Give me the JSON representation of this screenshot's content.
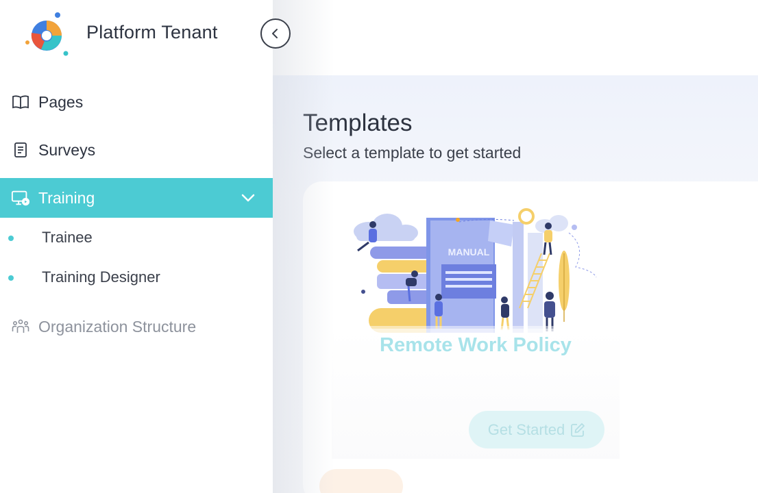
{
  "brand": {
    "name": "Platform Tenant",
    "logo_icon": "platform-logo-icon"
  },
  "sidebar": {
    "collapse_icon": "chevron-left-icon",
    "items": [
      {
        "label": "Pages",
        "icon": "book-icon"
      },
      {
        "label": "Surveys",
        "icon": "document-icon"
      },
      {
        "label": "Training",
        "icon": "monitor-icon",
        "active": true,
        "expanded": true,
        "children": [
          {
            "label": "Trainee"
          },
          {
            "label": "Training Designer"
          }
        ]
      },
      {
        "label": "Organization Structure",
        "icon": "people-icon",
        "muted": true
      }
    ]
  },
  "main": {
    "title": "Templates",
    "subtitle": "Select a template to get started",
    "card": {
      "illustration_text": "MANUAL",
      "title": "Remote Work Policy",
      "button_label": "Get Started",
      "button_icon": "edit-icon"
    }
  },
  "colors": {
    "accent": "#4ccbd3",
    "title_faded": "#a8e3ea",
    "content_bg": "#eef2fb"
  }
}
